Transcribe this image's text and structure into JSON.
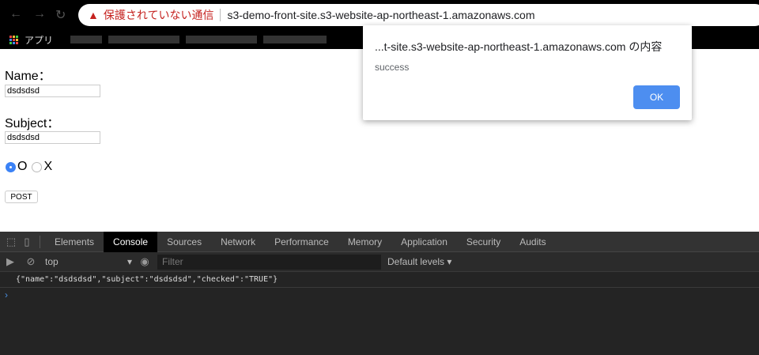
{
  "browser": {
    "security_warning": "保護されていない通信",
    "url": "s3-demo-front-site.s3-website-ap-northeast-1.amazonaws.com",
    "bookmarks_apps": "アプリ"
  },
  "form": {
    "name_label": "Name：",
    "name_value": "dsdsdsd",
    "subject_label": "Subject：",
    "subject_value": "dsdsdsd",
    "radio_o": "O",
    "radio_x": "X",
    "post_label": "POST"
  },
  "dialog": {
    "title": "...t-site.s3-website-ap-northeast-1.amazonaws.com の内容",
    "message": "success",
    "ok_label": "OK"
  },
  "devtools": {
    "tabs": [
      "Elements",
      "Console",
      "Sources",
      "Network",
      "Performance",
      "Memory",
      "Application",
      "Security",
      "Audits"
    ],
    "context": "top",
    "filter_placeholder": "Filter",
    "levels": "Default levels ▾",
    "log": "{\"name\":\"dsdsdsd\",\"subject\":\"dsdsdsd\",\"checked\":\"TRUE\"}"
  }
}
